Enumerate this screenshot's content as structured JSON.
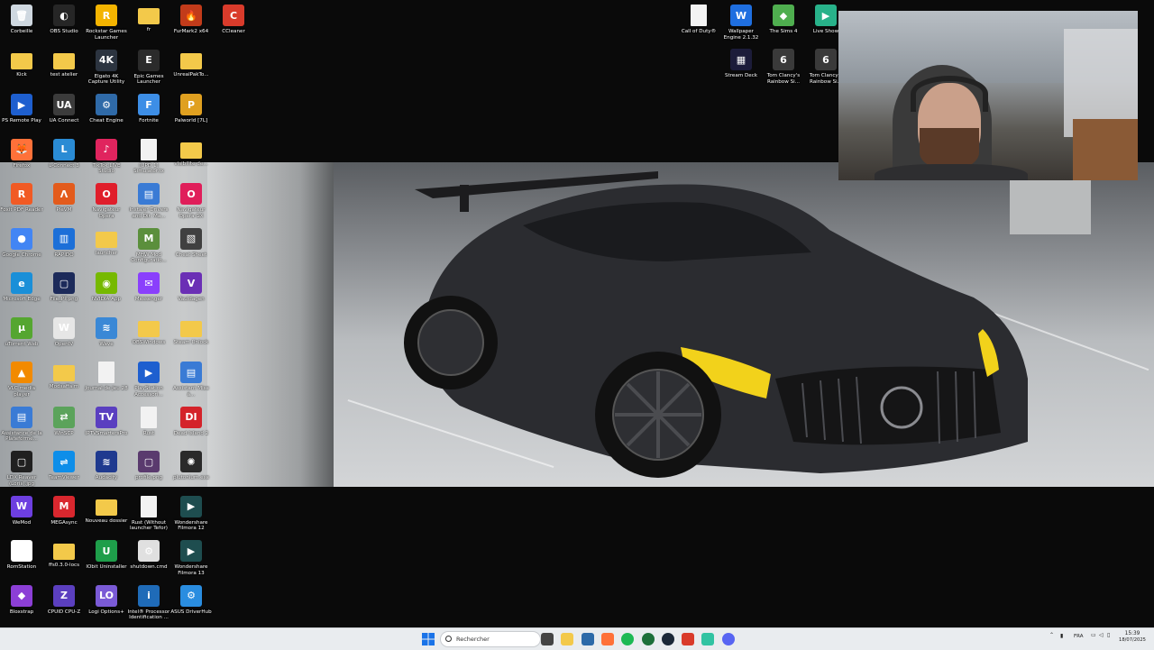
{
  "desktop_icons_left": [
    {
      "label": "Corbeille",
      "icon": "recycle-bin-icon",
      "color": "#cfd8e0",
      "glyph": "🗑"
    },
    {
      "label": "OBS Studio",
      "icon": "obs-icon",
      "color": "#262626",
      "glyph": "◐"
    },
    {
      "label": "Rockstar Games Launcher",
      "icon": "rockstar-icon",
      "color": "#f4b400",
      "glyph": "R"
    },
    {
      "label": "fr",
      "icon": "folder-icon",
      "color": "#f3c94a",
      "glyph": ""
    },
    {
      "label": "FurMark2 x64",
      "icon": "furmark-icon",
      "color": "#c23b1a",
      "glyph": "🔥"
    },
    {
      "label": "CCleaner",
      "icon": "ccleaner-icon",
      "color": "#d93b2b",
      "glyph": "C"
    },
    {
      "label": "Kick",
      "icon": "folder-icon",
      "color": "#f3c94a",
      "glyph": ""
    },
    {
      "label": "test atelier",
      "icon": "folder-icon",
      "color": "#f3c94a",
      "glyph": ""
    },
    {
      "label": "Elgato 4K Capture Utility",
      "icon": "elgato-icon",
      "color": "#2c3440",
      "glyph": "4K"
    },
    {
      "label": "Epic Games Launcher",
      "icon": "epic-icon",
      "color": "#2b2b2b",
      "glyph": "E"
    },
    {
      "label": "UnrealPakTo...",
      "icon": "folder-icon",
      "color": "#f3c94a",
      "glyph": ""
    },
    {
      "label": "PS Remote Play",
      "icon": "ps-remote-icon",
      "color": "#1e5fcf",
      "glyph": "▶"
    },
    {
      "label": "UA Connect",
      "icon": "ua-icon",
      "color": "#3b3b3b",
      "glyph": "UA"
    },
    {
      "label": "Cheat Engine",
      "icon": "cheat-engine-icon",
      "color": "#2f6aa8",
      "glyph": "⚙"
    },
    {
      "label": "Fortnite",
      "icon": "fortnite-icon",
      "color": "#3d8ee6",
      "glyph": "F"
    },
    {
      "label": "Palworld [7L]",
      "icon": "palworld-icon",
      "color": "#e0a020",
      "glyph": "P"
    },
    {
      "label": "Firefox",
      "icon": "firefox-icon",
      "color": "#ff7139",
      "glyph": "🦊"
    },
    {
      "label": "L-Connect 3",
      "icon": "lconnect-icon",
      "color": "#2a8bd4",
      "glyph": "L"
    },
    {
      "label": "TikTok LIVE Studio",
      "icon": "tiktok-icon",
      "color": "#e0245e",
      "glyph": "♪"
    },
    {
      "label": "[UPD 1] Simulator.tx",
      "icon": "document-icon",
      "color": "#f2f2f2",
      "glyph": ""
    },
    {
      "label": "visibilite de...",
      "icon": "folder-icon",
      "color": "#f3c94a",
      "glyph": ""
    },
    {
      "label": "Foxit PDF Reader",
      "icon": "foxit-icon",
      "color": "#f15a24",
      "glyph": "R"
    },
    {
      "label": "PieVM",
      "icon": "pievm-icon",
      "color": "#e35b1c",
      "glyph": "Λ"
    },
    {
      "label": "Navigateur Opera",
      "icon": "opera-icon",
      "color": "#e01e2b",
      "glyph": "O"
    },
    {
      "label": "Instaler Drivers and Dir. Ma...",
      "icon": "installer-icon",
      "color": "#3a7bd5",
      "glyph": "▤"
    },
    {
      "label": "Navigateur Opera GX",
      "icon": "opera-gx-icon",
      "color": "#e01e5a",
      "glyph": "O"
    },
    {
      "label": "Google Chrome",
      "icon": "chrome-icon",
      "color": "#4285f4",
      "glyph": "●"
    },
    {
      "label": "RAPIDO",
      "icon": "rapido-icon",
      "color": "#1c6fd8",
      "glyph": "▥"
    },
    {
      "label": "launcher",
      "icon": "folder-icon",
      "color": "#f3c94a",
      "glyph": ""
    },
    {
      "label": "MHW Mod Configuratio...",
      "icon": "mhw-icon",
      "color": "#5b8f3c",
      "glyph": "M"
    },
    {
      "label": "Cheat Sheet",
      "icon": "cheat-sheet-icon",
      "color": "#404040",
      "glyph": "▧"
    },
    {
      "label": "Microsoft Edge",
      "icon": "edge-icon",
      "color": "#1a8fd8",
      "glyph": "e"
    },
    {
      "label": "File_PP.png",
      "icon": "image-icon",
      "color": "#1c2a5a",
      "glyph": "▢"
    },
    {
      "label": "NVIDIA App",
      "icon": "nvidia-icon",
      "color": "#76b900",
      "glyph": "◉"
    },
    {
      "label": "Messenger",
      "icon": "messenger-icon",
      "color": "#8a3ffc",
      "glyph": "✉"
    },
    {
      "label": "Vauldagen",
      "icon": "vault-icon",
      "color": "#6b2fb5",
      "glyph": "V"
    },
    {
      "label": "uTorrent Web",
      "icon": "utorrent-icon",
      "color": "#55a630",
      "glyph": "µ"
    },
    {
      "label": "OpenIV",
      "icon": "openiv-icon",
      "color": "#e6e6e6",
      "glyph": "W"
    },
    {
      "label": "Wave",
      "icon": "wave-icon",
      "color": "#3a88d6",
      "glyph": "≋"
    },
    {
      "label": "OBSWindows",
      "icon": "folder-icon",
      "color": "#f3c94a",
      "glyph": ""
    },
    {
      "label": "Steam Unlock",
      "icon": "folder-icon",
      "color": "#f3c94a",
      "glyph": ""
    },
    {
      "label": "VLC media player",
      "icon": "vlc-icon",
      "color": "#f28a00",
      "glyph": "▲"
    },
    {
      "label": "Modsaffaim",
      "icon": "folder-icon",
      "color": "#f3c94a",
      "glyph": ""
    },
    {
      "label": "Journal de jeu 28",
      "icon": "document-icon",
      "color": "#f2f2f2",
      "glyph": ""
    },
    {
      "label": "PlayStation Accessori...",
      "icon": "playstation-icon",
      "color": "#1e5fcf",
      "glyph": "▶"
    },
    {
      "label": "Assistant Mise à...",
      "icon": "installer-icon",
      "color": "#3a7bd5",
      "glyph": "▤"
    },
    {
      "label": "Assistance de la Plateforme...",
      "icon": "installer-icon",
      "color": "#3a7bd5",
      "glyph": "▤"
    },
    {
      "label": "WinSCP",
      "icon": "winscp-icon",
      "color": "#5ba35b",
      "glyph": "⇄"
    },
    {
      "label": "IPTVSmartersPro",
      "icon": "iptv-icon",
      "color": "#5a3fc0",
      "glyph": "TV"
    },
    {
      "label": "Rust",
      "icon": "document-icon",
      "color": "#f2f2f2",
      "glyph": ""
    },
    {
      "label": "Dead Island 2",
      "icon": "dead-island-icon",
      "color": "#d4232a",
      "glyph": "DI"
    },
    {
      "label": "LDX Reaver (Loris).jpg",
      "icon": "image-icon",
      "color": "#202020",
      "glyph": "▢"
    },
    {
      "label": "TeamViewer",
      "icon": "teamviewer-icon",
      "color": "#0e8ee9",
      "glyph": "⇌"
    },
    {
      "label": "Audacity",
      "icon": "audacity-icon",
      "color": "#1f3a8f",
      "glyph": "≋"
    },
    {
      "label": "profile.png",
      "icon": "image-icon",
      "color": "#5a3a6e",
      "glyph": "▢"
    },
    {
      "label": "plutonium.exe",
      "icon": "plutonium-icon",
      "color": "#2a2a2a",
      "glyph": "✺"
    },
    {
      "label": "WeMod",
      "icon": "wemod-icon",
      "color": "#6d3fe0",
      "glyph": "W"
    },
    {
      "label": "MEGAsync",
      "icon": "mega-icon",
      "color": "#d9272e",
      "glyph": "M"
    },
    {
      "label": "Nouveau dossier",
      "icon": "folder-icon",
      "color": "#f3c94a",
      "glyph": ""
    },
    {
      "label": "Rust (Without launcher Tefor)",
      "icon": "document-icon",
      "color": "#f2f2f2",
      "glyph": ""
    },
    {
      "label": "Wondershare Filmora 12",
      "icon": "filmora-icon",
      "color": "#1e4d4f",
      "glyph": "▶"
    },
    {
      "label": "RomStation",
      "icon": "romstation-icon",
      "color": "#ffffff",
      "glyph": "✿"
    },
    {
      "label": "ffs0.3.0-locs",
      "icon": "folder-icon",
      "color": "#f3c94a",
      "glyph": ""
    },
    {
      "label": "IObit Uninstaller",
      "icon": "iobit-icon",
      "color": "#1e9e4a",
      "glyph": "U"
    },
    {
      "label": "shutdown.cmd",
      "icon": "cmd-icon",
      "color": "#e0e0e0",
      "glyph": "⚙"
    },
    {
      "label": "Wondershare Filmora 13",
      "icon": "filmora-icon",
      "color": "#1e4d4f",
      "glyph": "▶"
    },
    {
      "label": "Bloxstrap",
      "icon": "bloxstrap-icon",
      "color": "#8c3fd6",
      "glyph": "◆"
    },
    {
      "label": "CPUID CPU-Z",
      "icon": "cpuz-icon",
      "color": "#5b3fbf",
      "glyph": "Z"
    },
    {
      "label": "Logi Options+",
      "icon": "logi-icon",
      "color": "#7a5ad6",
      "glyph": "LO"
    },
    {
      "label": "Intel® Processor Identification ...",
      "icon": "intel-icon",
      "color": "#1f6bb8",
      "glyph": "i"
    },
    {
      "label": "ASUS DriverHub",
      "icon": "asus-icon",
      "color": "#2a8de0",
      "glyph": "⚙"
    }
  ],
  "desktop_icons_right": [
    {
      "label": "Call of Duty®",
      "icon": "document-icon",
      "color": "#f2f2f2",
      "glyph": ""
    },
    {
      "label": "Wallpaper Engine 2.1.32",
      "icon": "wallpaper-engine-icon",
      "color": "#1f6fe0",
      "glyph": "W"
    },
    {
      "label": "The Sims 4",
      "icon": "sims-icon",
      "color": "#4fae4f",
      "glyph": "◆"
    },
    {
      "label": "Live Show",
      "icon": "liveshow-icon",
      "color": "#28b28a",
      "glyph": "▶"
    },
    {
      "label": "Stream Deck",
      "icon": "stream-deck-icon",
      "color": "#1c1c3a",
      "glyph": "▦"
    },
    {
      "label": "Tom Clancy's Rainbow Si...",
      "icon": "rainbow-six-icon",
      "color": "#3a3a3a",
      "glyph": "6"
    },
    {
      "label": "Tom Clancy's Rainbow Si...",
      "icon": "rainbow-six-icon",
      "color": "#3a3a3a",
      "glyph": "6"
    }
  ],
  "taskbar": {
    "search_placeholder": "Rechercher",
    "language": "FRA",
    "time": "15:39",
    "date": "18/07/2025"
  },
  "taskbar_apps": [
    {
      "name": "task-view-icon",
      "color": "#444"
    },
    {
      "name": "file-explorer-icon",
      "color": "#f3c94a"
    },
    {
      "name": "calculator-icon",
      "color": "#2d6aa8"
    },
    {
      "name": "firefox-icon",
      "color": "#ff7139"
    },
    {
      "name": "spotify-icon",
      "color": "#1db954"
    },
    {
      "name": "utorrent-icon",
      "color": "#1d6f3a"
    },
    {
      "name": "steam-icon",
      "color": "#1b2838"
    },
    {
      "name": "ccleaner-icon",
      "color": "#d93b2b"
    },
    {
      "name": "streamlabs-icon",
      "color": "#31c3a2"
    },
    {
      "name": "discord-icon",
      "color": "#5865f2"
    }
  ]
}
